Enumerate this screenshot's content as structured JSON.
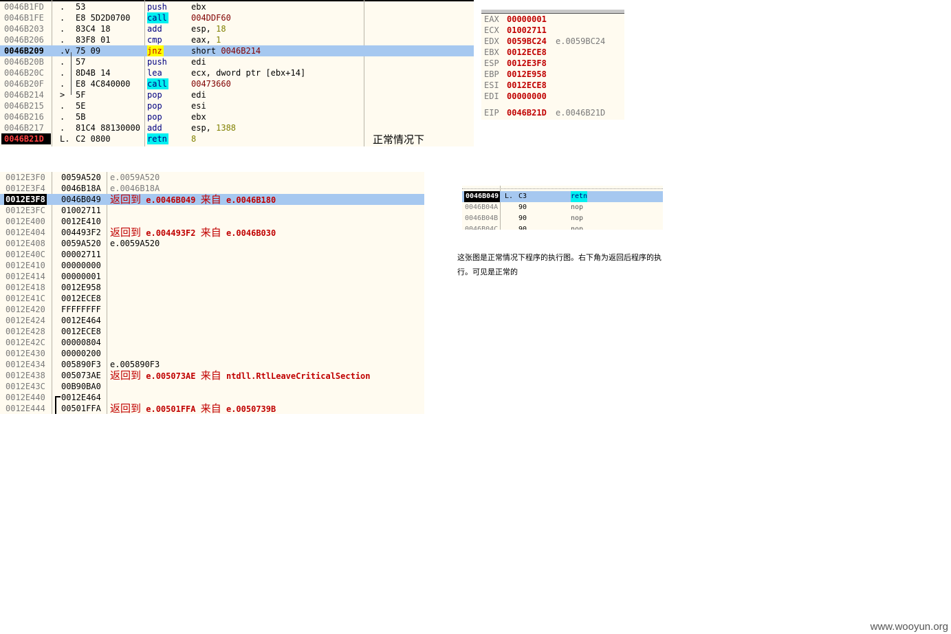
{
  "disassembly": {
    "rows": [
      {
        "addr": "0046B1FD",
        "mark": ".",
        "hex": "53",
        "mnemonic": "push",
        "operands": [
          {
            "t": "ebx"
          }
        ]
      },
      {
        "addr": "0046B1FE",
        "mark": ".",
        "hex": "E8 5D2D0700",
        "mnemonic": "call",
        "operands": [
          {
            "t": "004DDF60",
            "k": "tgt"
          }
        ]
      },
      {
        "addr": "0046B203",
        "mark": ".",
        "hex": "83C4 18",
        "mnemonic": "add",
        "operands": [
          {
            "t": "esp, "
          },
          {
            "t": "18",
            "k": "num"
          }
        ]
      },
      {
        "addr": "0046B206",
        "mark": ".",
        "hex": "83F8 01",
        "mnemonic": "cmp",
        "operands": [
          {
            "t": "eax, "
          },
          {
            "t": "1",
            "k": "num"
          }
        ]
      },
      {
        "addr": "0046B209",
        "mark": ".v",
        "hex": "75 09",
        "mnemonic": "jnz",
        "operands": [
          {
            "t": "short "
          },
          {
            "t": "0046B214",
            "k": "tgt"
          }
        ],
        "selected": true
      },
      {
        "addr": "0046B20B",
        "mark": ".",
        "hex": "57",
        "mnemonic": "push",
        "operands": [
          {
            "t": "edi"
          }
        ]
      },
      {
        "addr": "0046B20C",
        "mark": ".",
        "hex": "8D4B 14",
        "mnemonic": "lea",
        "operands": [
          {
            "t": "ecx, dword ptr [ebx+14]"
          }
        ]
      },
      {
        "addr": "0046B20F",
        "mark": ".",
        "hex": "E8 4C840000",
        "mnemonic": "call",
        "operands": [
          {
            "t": "00473660",
            "k": "tgt"
          }
        ]
      },
      {
        "addr": "0046B214",
        "mark": ">",
        "hex": "5F",
        "mnemonic": "pop",
        "operands": [
          {
            "t": "edi"
          }
        ]
      },
      {
        "addr": "0046B215",
        "mark": ".",
        "hex": "5E",
        "mnemonic": "pop",
        "operands": [
          {
            "t": "esi"
          }
        ]
      },
      {
        "addr": "0046B216",
        "mark": ".",
        "hex": "5B",
        "mnemonic": "pop",
        "operands": [
          {
            "t": "ebx"
          }
        ]
      },
      {
        "addr": "0046B217",
        "mark": ".",
        "hex": "81C4 88130000",
        "mnemonic": "add",
        "operands": [
          {
            "t": "esp, "
          },
          {
            "t": "1388",
            "k": "num"
          }
        ]
      },
      {
        "addr": "0046B21D",
        "mark": "L.",
        "hex": "C2 0800",
        "mnemonic": "retn",
        "operands": [
          {
            "t": "8",
            "k": "num"
          }
        ],
        "eip": true
      }
    ],
    "note": "正常情况下"
  },
  "registers": [
    {
      "name": "EAX",
      "value": "00000001",
      "comment": ""
    },
    {
      "name": "ECX",
      "value": "01002711",
      "comment": ""
    },
    {
      "name": "EDX",
      "value": "0059BC24",
      "comment": "e.0059BC24"
    },
    {
      "name": "EBX",
      "value": "0012ECE8",
      "comment": ""
    },
    {
      "name": "ESP",
      "value": "0012E3F8",
      "comment": ""
    },
    {
      "name": "EBP",
      "value": "0012E958",
      "comment": ""
    },
    {
      "name": "ESI",
      "value": "0012ECE8",
      "comment": ""
    },
    {
      "name": "EDI",
      "value": "00000000",
      "comment": ""
    },
    {
      "name": "EIP",
      "value": "0046B21D",
      "comment": "e.0046B21D"
    }
  ],
  "stack": {
    "rows": [
      {
        "addr": "0012E3F0",
        "value": "0059A520",
        "comment": "e.0059A520"
      },
      {
        "addr": "0012E3F4",
        "value": "0046B18A",
        "comment": "e.0046B18A"
      },
      {
        "addr": "0012E3F8",
        "value": "0046B049",
        "ret": {
          "label": "返回到",
          "to": "e.0046B049",
          "from_label": "来自",
          "from": "e.0046B180"
        },
        "esp": true
      },
      {
        "addr": "0012E3FC",
        "value": "01002711"
      },
      {
        "addr": "0012E400",
        "value": "0012E410"
      },
      {
        "addr": "0012E404",
        "value": "004493F2",
        "ret": {
          "label": "返回到",
          "to": "e.004493F2",
          "from_label": "来自",
          "from": "e.0046B030"
        }
      },
      {
        "addr": "0012E408",
        "value": "0059A520",
        "comment": "e.0059A520",
        "dark": true
      },
      {
        "addr": "0012E40C",
        "value": "00002711"
      },
      {
        "addr": "0012E410",
        "value": "00000000"
      },
      {
        "addr": "0012E414",
        "value": "00000001"
      },
      {
        "addr": "0012E418",
        "value": "0012E958"
      },
      {
        "addr": "0012E41C",
        "value": "0012ECE8"
      },
      {
        "addr": "0012E420",
        "value": "FFFFFFFF"
      },
      {
        "addr": "0012E424",
        "value": "0012E464"
      },
      {
        "addr": "0012E428",
        "value": "0012ECE8"
      },
      {
        "addr": "0012E42C",
        "value": "00000804"
      },
      {
        "addr": "0012E430",
        "value": "00000200"
      },
      {
        "addr": "0012E434",
        "value": "005890F3",
        "comment": "e.005890F3",
        "dark": true
      },
      {
        "addr": "0012E438",
        "value": "005073AE",
        "ret": {
          "label": "返回到",
          "to": "e.005073AE",
          "from_label": "来自",
          "from": "ntdll.RtlLeaveCriticalSection"
        }
      },
      {
        "addr": "0012E43C",
        "value": "00B90BA0"
      },
      {
        "addr": "0012E440",
        "value": "0012E464"
      },
      {
        "addr": "0012E444",
        "value": "00501FFA",
        "ret": {
          "label": "返回到",
          "to": "e.00501FFA",
          "from_label": "来自",
          "from": "e.0050739B"
        }
      }
    ]
  },
  "mini_screenshot": {
    "rows": [
      {
        "addr": "0046B049",
        "mark": "L.",
        "hex": "C3",
        "mnemonic": "retn",
        "selected": true
      },
      {
        "addr": "0046B04A",
        "mark": "",
        "hex": "90",
        "mnemonic": "nop"
      },
      {
        "addr": "0046B04B",
        "mark": "",
        "hex": "90",
        "mnemonic": "nop"
      },
      {
        "addr": "0046B04C",
        "mark": "",
        "hex": "90",
        "mnemonic": "nop"
      }
    ]
  },
  "caption": "这张图是正常情况下程序的执行图。右下角为返回后程序的执行。可见是正常的",
  "watermark": "www.wooyun.org",
  "colors": {
    "pane_bg": "#fffbf0",
    "selection": "#a6c8f0",
    "call_highlight": "#00f0f0",
    "jump_highlight": "#ffff00",
    "register_value": "#c00000"
  }
}
